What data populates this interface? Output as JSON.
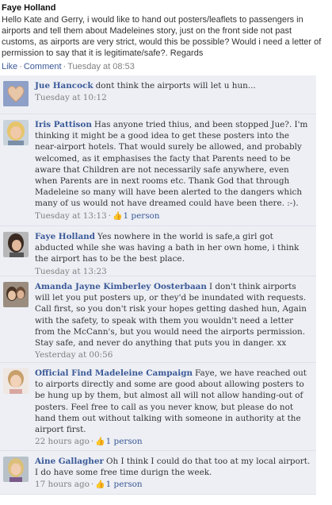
{
  "post": {
    "author": "Faye Holland",
    "text": "Hello Kate and Gerry, i would like to hand out posters/leaflets to passengers in airports and tell them about Madeleines story, just on the front side not past customs, as airports are very strict, would this be possible? Would i need a letter of permission to say that it is legitimate/safe?. Regards",
    "like_label": "Like",
    "comment_label": "Comment",
    "timestamp": "Tuesday at 08:53"
  },
  "comments": [
    {
      "author": "Jue Hancock",
      "text": "dont think the airports will let u hun...",
      "timestamp": "Tuesday at 10:12",
      "likes": "",
      "avatar": "heart-hands-photo"
    },
    {
      "author": "Iris Pattison",
      "text": "Has anyone tried thius, and been stopped Jue?. I'm thinking it might be a good idea to get these posters into the near-airport hotels. That would surely be allowed, and probably welcomed, as it emphasises the facty that Parents need to be aware that Children are not necessarily safe anywhere, even when Parents are in next rooms etc. Thank God that through Madeleine so many will have been alerted to the dangers which many of us would not have dreamed could have been there. :-).",
      "timestamp": "Tuesday at 13:13",
      "likes": "1 person",
      "avatar": "blonde-woman-photo"
    },
    {
      "author": "Faye Holland",
      "text": "Yes nowhere in the world is safe,a girl got abducted while she was having a bath in her own home, i think the airport has to be the best place.",
      "timestamp": "Tuesday at 13:23",
      "likes": "",
      "avatar": "dark-hair-photo"
    },
    {
      "author": "Amanda Jayne Kimberley Oosterbaan",
      "text": "I don't think airports will let you put posters up, or they'd be inundated with requests. Call first, so you don't risk your hopes getting dashed hun, Again with the safety, to speak with them you wouldn't need a letter from the McCann's, but you would need the airports permission. Stay safe, and never do anything that puts you in danger. xx",
      "timestamp": "Yesterday at 00:56",
      "likes": "",
      "avatar": "couple-photo"
    },
    {
      "author": "Official Find Madeleine Campaign",
      "text": "Faye, we have reached out to airports directly and some are good about allowing posters to be hung up by them, but almost all will not allow handing-out of posters. Feel free to call as you never know, but please do not hand them out without talking with someone in authority at the airport first.",
      "timestamp": "22 hours ago",
      "likes": "1 person",
      "avatar": "child-portrait-photo"
    },
    {
      "author": "Aine Gallagher",
      "text": "Oh I think I could do that too at my local airport. I do have some free time durign the week.",
      "timestamp": "17 hours ago",
      "likes": "1 person",
      "avatar": "blonde-girl-photo"
    }
  ]
}
